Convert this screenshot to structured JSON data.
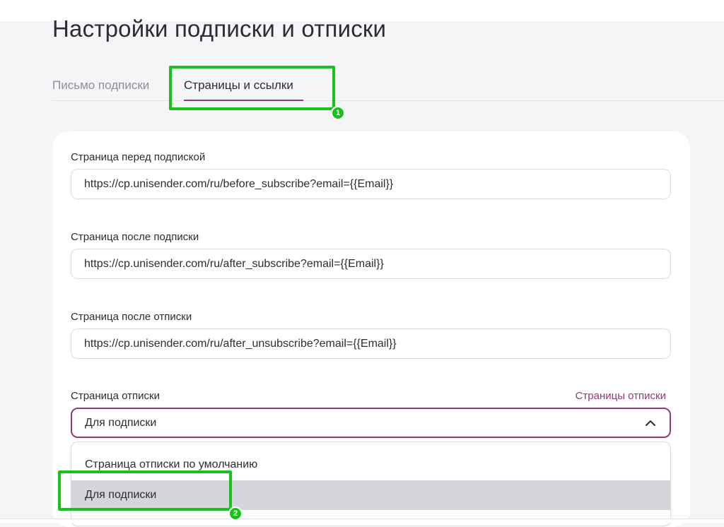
{
  "page": {
    "title": "Настройки подписки и отписки"
  },
  "tabs": [
    {
      "label": "Письмо подписки",
      "active": false
    },
    {
      "label": "Страницы и ссылки",
      "active": true
    }
  ],
  "fields": {
    "before_subscribe": {
      "label": "Страница перед подпиской",
      "value": "https://cp.unisender.com/ru/before_subscribe?email={{Email}}"
    },
    "after_subscribe": {
      "label": "Страница после подписки",
      "value": "https://cp.unisender.com/ru/after_subscribe?email={{Email}}"
    },
    "after_unsubscribe": {
      "label": "Страница после отписки",
      "value": "https://cp.unisender.com/ru/after_unsubscribe?email={{Email}}"
    },
    "unsubscribe_page": {
      "label": "Страница отписки",
      "link": "Страницы отписки",
      "selected": "Для подписки",
      "options": [
        "Страница отписки по умолчанию",
        "Для подписки"
      ]
    }
  },
  "annotations": {
    "badge_1": "1",
    "badge_2": "2"
  },
  "colors": {
    "accent": "#8e3a7b",
    "highlight": "#19c21a",
    "selected_option_bg": "#d4d6dc"
  }
}
